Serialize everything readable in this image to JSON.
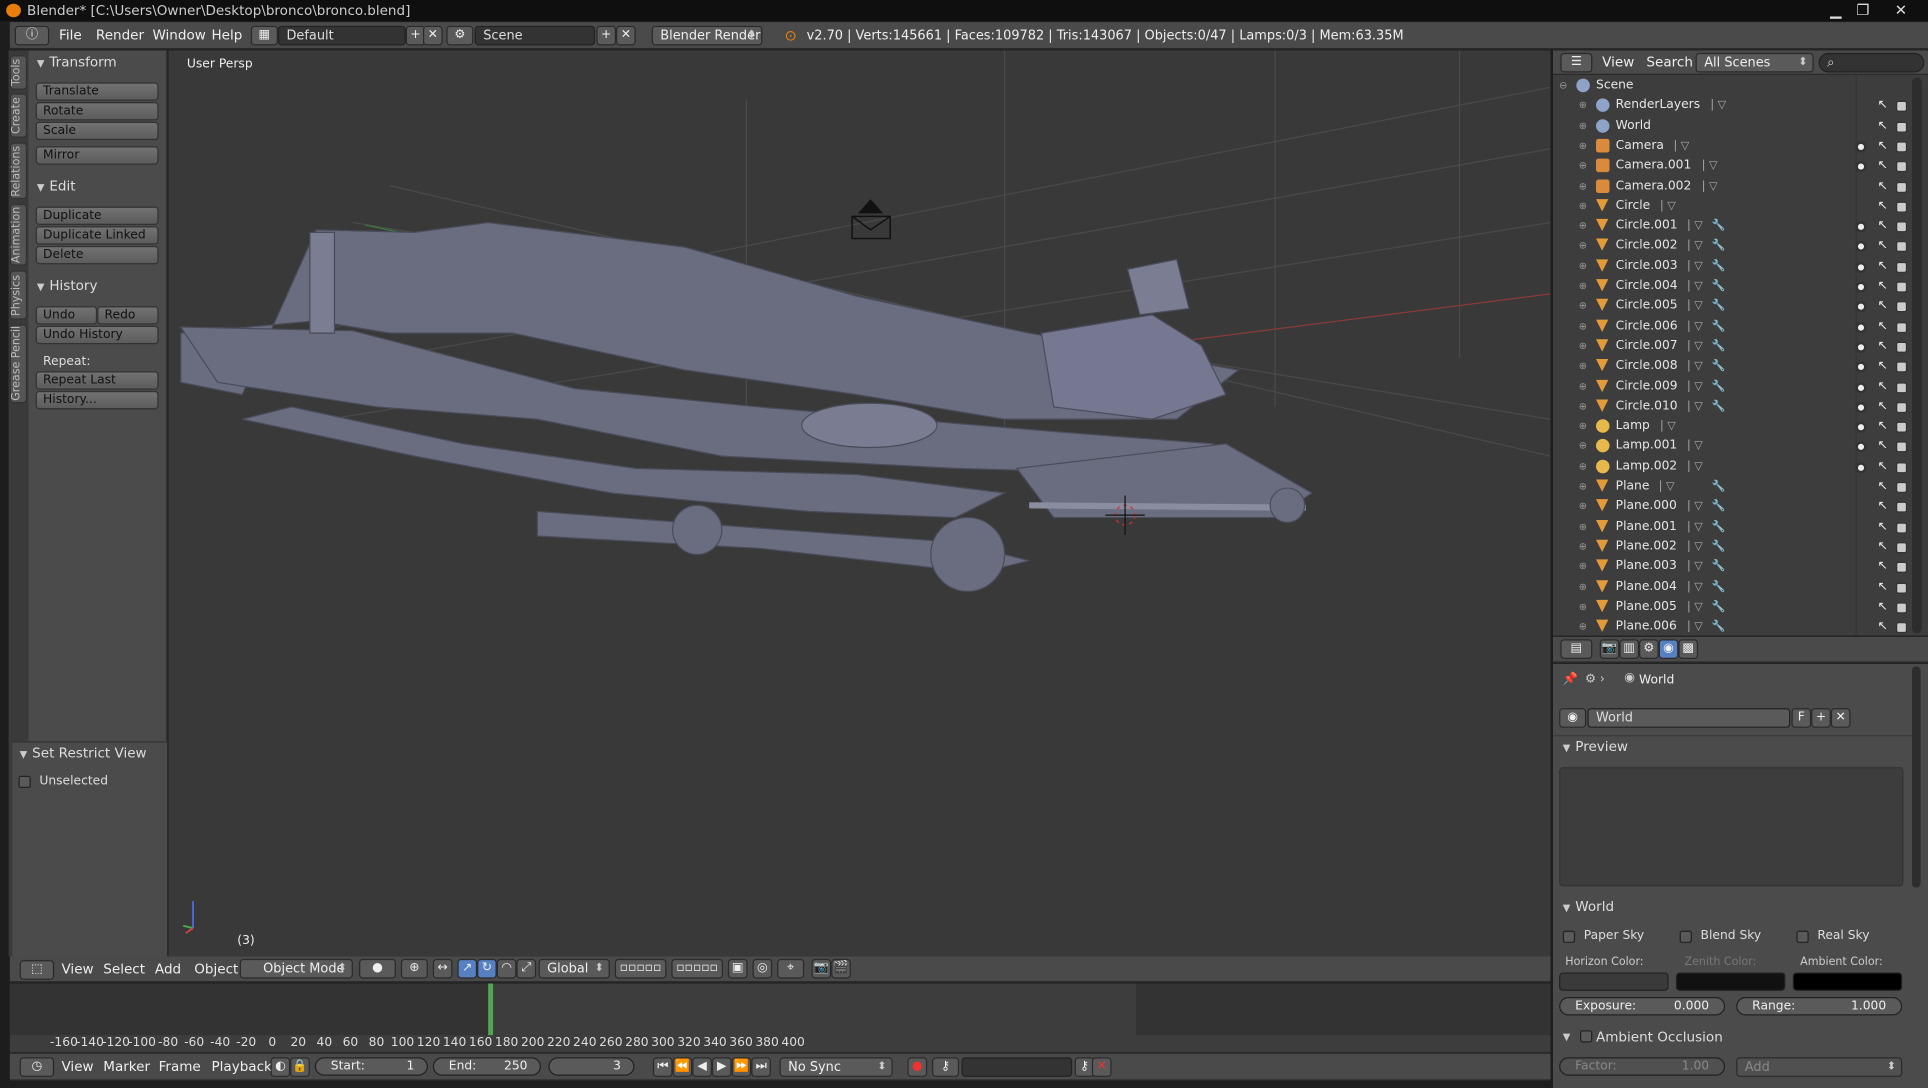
{
  "window": {
    "title": "Blender* [C:\\Users\\Owner\\Desktop\\bronco\\bronco.blend]",
    "min": "▁",
    "max": "❐",
    "close": "✕"
  },
  "info": {
    "menus": [
      "File",
      "Render",
      "Window",
      "Help"
    ],
    "layout": "Default",
    "scene": "Scene",
    "engine": "Blender Render",
    "stats": "v2.70 | Verts:145661 | Faces:109782 | Tris:143067 | Objects:0/47 | Lamps:0/3 | Mem:63.35M"
  },
  "tabs": [
    "Tools",
    "Create",
    "Relations",
    "Animation",
    "Physics",
    "Grease Pencil"
  ],
  "toolshelf": {
    "transform": {
      "title": "Transform",
      "buttons": [
        "Translate",
        "Rotate",
        "Scale",
        "Mirror"
      ]
    },
    "edit": {
      "title": "Edit",
      "buttons": [
        "Duplicate",
        "Duplicate Linked",
        "Delete"
      ]
    },
    "history": {
      "title": "History",
      "undo": "Undo",
      "redo": "Redo",
      "undo_history": "Undo History",
      "repeat_label": "Repeat:",
      "repeat_last": "Repeat Last",
      "history": "History..."
    },
    "restrict": {
      "title": "Set Restrict View",
      "unselected": "Unselected"
    }
  },
  "viewport": {
    "label": "User Persp",
    "frame": "(3)"
  },
  "v3d_header": {
    "view": "View",
    "select": "Select",
    "add": "Add",
    "object": "Object",
    "mode": "Object Mode",
    "orientation": "Global"
  },
  "outliner": {
    "view": "View",
    "search": "Search",
    "filter": "All Scenes",
    "rows": [
      {
        "name": "Scene",
        "type": "scene",
        "indent": 0
      },
      {
        "name": "RenderLayers",
        "type": "rl",
        "indent": 1
      },
      {
        "name": "World",
        "type": "world",
        "indent": 1
      },
      {
        "name": "Camera",
        "type": "cam",
        "indent": 1,
        "vis": true
      },
      {
        "name": "Camera.001",
        "type": "cam",
        "indent": 1,
        "vis": true
      },
      {
        "name": "Camera.002",
        "type": "cam",
        "indent": 1,
        "vis": false
      },
      {
        "name": "Circle",
        "type": "mesh",
        "indent": 1,
        "vis": false
      },
      {
        "name": "Circle.001",
        "type": "mesh",
        "indent": 1,
        "vis": true,
        "mod": true
      },
      {
        "name": "Circle.002",
        "type": "mesh",
        "indent": 1,
        "vis": true,
        "mod": true
      },
      {
        "name": "Circle.003",
        "type": "mesh",
        "indent": 1,
        "vis": true,
        "mod": true
      },
      {
        "name": "Circle.004",
        "type": "mesh",
        "indent": 1,
        "vis": true,
        "mod": true
      },
      {
        "name": "Circle.005",
        "type": "mesh",
        "indent": 1,
        "vis": true,
        "mod": true
      },
      {
        "name": "Circle.006",
        "type": "mesh",
        "indent": 1,
        "vis": true,
        "mod": true
      },
      {
        "name": "Circle.007",
        "type": "mesh",
        "indent": 1,
        "vis": true,
        "mod": true
      },
      {
        "name": "Circle.008",
        "type": "mesh",
        "indent": 1,
        "vis": true,
        "mod": true
      },
      {
        "name": "Circle.009",
        "type": "mesh",
        "indent": 1,
        "vis": true,
        "mod": true
      },
      {
        "name": "Circle.010",
        "type": "mesh",
        "indent": 1,
        "vis": true,
        "mod": true
      },
      {
        "name": "Lamp",
        "type": "lamp",
        "indent": 1,
        "vis": true
      },
      {
        "name": "Lamp.001",
        "type": "lamp",
        "indent": 1,
        "vis": true
      },
      {
        "name": "Lamp.002",
        "type": "lamp",
        "indent": 1,
        "vis": true
      },
      {
        "name": "Plane",
        "type": "mesh",
        "indent": 1,
        "vis": false,
        "mod": true
      },
      {
        "name": "Plane.000",
        "type": "mesh",
        "indent": 1,
        "vis": false,
        "mod": true
      },
      {
        "name": "Plane.001",
        "type": "mesh",
        "indent": 1,
        "vis": false,
        "mod": true
      },
      {
        "name": "Plane.002",
        "type": "mesh",
        "indent": 1,
        "vis": false,
        "mod": true
      },
      {
        "name": "Plane.003",
        "type": "mesh",
        "indent": 1,
        "vis": false,
        "mod": true
      },
      {
        "name": "Plane.004",
        "type": "mesh",
        "indent": 1,
        "vis": false,
        "mod": true
      },
      {
        "name": "Plane.005",
        "type": "mesh",
        "indent": 1,
        "vis": false,
        "mod": true
      },
      {
        "name": "Plane.006",
        "type": "mesh",
        "indent": 1,
        "vis": false,
        "mod": true
      }
    ]
  },
  "properties": {
    "breadcrumb": "World",
    "datablock": "World",
    "fake": "F",
    "preview": "Preview",
    "world_panel": "World",
    "paper_sky": "Paper Sky",
    "blend_sky": "Blend Sky",
    "real_sky": "Real Sky",
    "horizon": "Horizon Color:",
    "zenith": "Zenith Color:",
    "ambient": "Ambient Color:",
    "exposure_label": "Exposure:",
    "exposure": "0.000",
    "range_label": "Range:",
    "range": "1.000",
    "ao": "Ambient Occlusion",
    "factor_label": "Factor:",
    "factor": "1.00",
    "add": "Add"
  },
  "timeline": {
    "ticks": [
      "-160",
      "-140",
      "-120",
      "-100",
      "-80",
      "-60",
      "-40",
      "-20",
      "0",
      "20",
      "40",
      "60",
      "80",
      "100",
      "120",
      "140",
      "160",
      "180",
      "200",
      "220",
      "240",
      "260",
      "280",
      "300",
      "320",
      "340",
      "360",
      "380",
      "400"
    ],
    "view": "View",
    "marker": "Marker",
    "frame": "Frame",
    "playback": "Playback",
    "start_label": "Start:",
    "start": "1",
    "end_label": "End:",
    "end": "250",
    "current": "3",
    "sync": "No Sync"
  }
}
